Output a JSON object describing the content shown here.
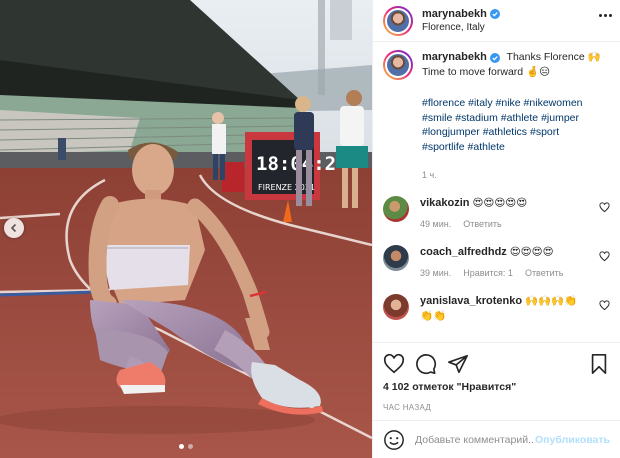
{
  "post": {
    "username": "marynabekh",
    "location": "Florence, Italy",
    "caption_text_1": "Thanks Florence 🙌",
    "caption_text_2": "Time to move forward 🤞😑",
    "hashtags_1": "#florence #italy #nike #nikewomen",
    "hashtags_2": "#smile #stadium #athlete #jumper",
    "hashtags_3": "#longjumper #athletics #sport",
    "hashtags_4": "#sportlife #athlete",
    "time_ago": "1 ч."
  },
  "scoreboard": {
    "time": "18:04:24",
    "city": "FIRENZE 2021"
  },
  "comments": [
    {
      "user": "vikakozin",
      "text": "😍😍😍😍😍",
      "time": "49 мин.",
      "reply": "Ответить",
      "replies": ""
    },
    {
      "user": "coach_alfredhdz",
      "text": "😍😍😍😍",
      "time": "39 мин.",
      "reply": "Ответить",
      "replies": "Нравится: 1"
    },
    {
      "user": "yanislava_krotenko",
      "text": "🙌🙌🙌👏",
      "text2": "👏👏",
      "time": "",
      "reply": "",
      "replies": ""
    }
  ],
  "actions": {
    "likes_text": "4 102 отметок \"Нравится\"",
    "posted_ago": "ЧАС НАЗАД"
  },
  "add_comment": {
    "placeholder": "Добавьте комментарий...",
    "publish_label": "Опубликовать"
  },
  "carousel": {
    "slide_count": 2,
    "active_slide": 1
  },
  "colors": {
    "link": "#00376b",
    "muted": "#8e8e8e",
    "track": "#9c4a3c",
    "publish": "#b2dffc"
  },
  "icons": [
    "verified-badge-icon",
    "more-options-icon",
    "heart-icon",
    "comment-icon",
    "share-icon",
    "bookmark-icon",
    "emoji-icon",
    "chevron-left-icon"
  ]
}
